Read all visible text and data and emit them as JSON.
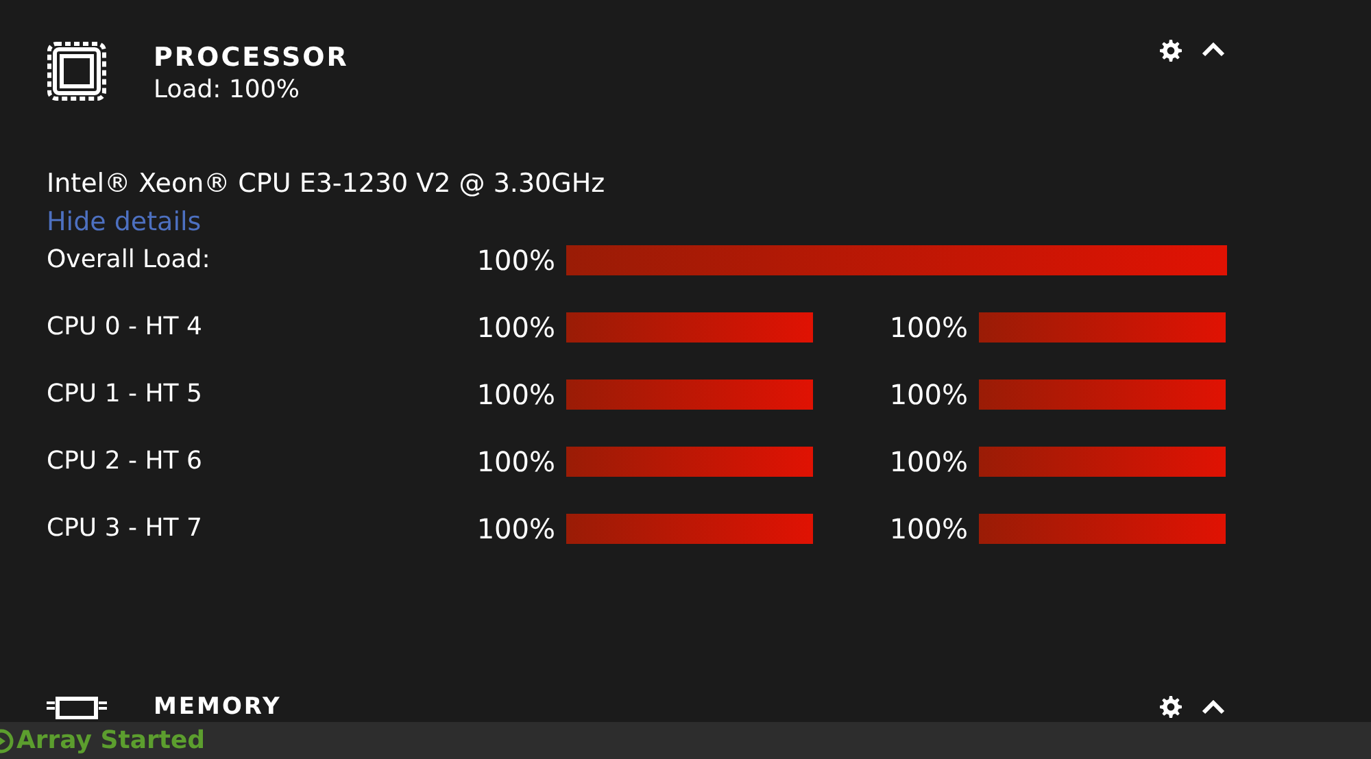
{
  "processor": {
    "title": "PROCESSOR",
    "load": "Load: 100%",
    "cpu_name": "Intel® Xeon® CPU E3-1230 V2 @ 3.30GHz",
    "details_link": "Hide details",
    "expanded": true,
    "overall": {
      "label": "Overall Load:",
      "reading": "100%",
      "level": 1.0
    },
    "cores": [
      {
        "label": "CPU 0 - HT 4",
        "threads": [
          {
            "reading": "100%",
            "level": 1.0
          },
          {
            "reading": "100%",
            "level": 1.0
          }
        ]
      },
      {
        "label": "CPU 1 - HT 5",
        "threads": [
          {
            "reading": "100%",
            "level": 1.0
          },
          {
            "reading": "100%",
            "level": 1.0
          }
        ]
      },
      {
        "label": "CPU 2 - HT 6",
        "threads": [
          {
            "reading": "100%",
            "level": 1.0
          },
          {
            "reading": "100%",
            "level": 1.0
          }
        ]
      },
      {
        "label": "CPU 3 - HT 7",
        "threads": [
          {
            "reading": "100%",
            "level": 1.0
          },
          {
            "reading": "100%",
            "level": 1.0
          }
        ]
      }
    ]
  },
  "memory": {
    "title": "MEMORY",
    "expanded": true
  },
  "status_bar": {
    "text": "Array Started"
  }
}
